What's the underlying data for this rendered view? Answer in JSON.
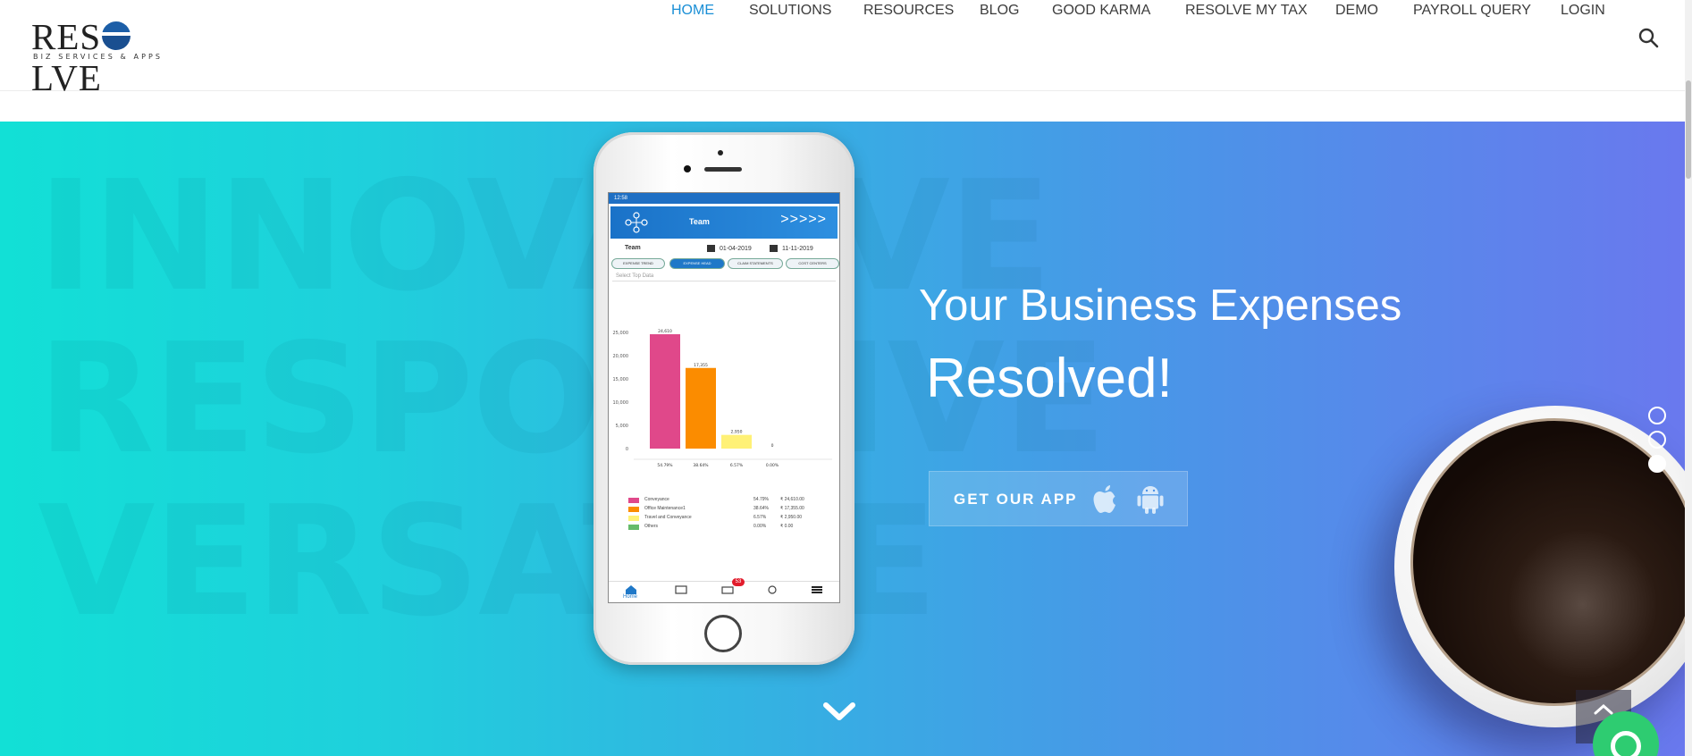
{
  "brand": {
    "name": "RESOLVE",
    "name_left": "RES",
    "name_right": "LVE",
    "tagline": "BIZ SERVICES & APPS"
  },
  "nav": {
    "items": [
      {
        "label": "HOME",
        "active": true
      },
      {
        "label": "SOLUTIONS",
        "active": false
      },
      {
        "label": "RESOURCES",
        "active": false
      },
      {
        "label": "BLOG",
        "active": false
      },
      {
        "label": "GOOD KARMA",
        "active": false
      },
      {
        "label": "RESOLVE MY TAX",
        "active": false
      },
      {
        "label": "DEMO",
        "active": false
      },
      {
        "label": "PAYROLL QUERY",
        "active": false
      },
      {
        "label": "LOGIN",
        "active": false
      }
    ],
    "search_icon": "search-icon",
    "active_color": "#1a8fd6"
  },
  "hero": {
    "background_words": [
      "INNOVATIVE",
      "RESPONSIVE",
      "VERSATILE"
    ],
    "headline_line1": "Your Business Expenses",
    "headline_line2": "Resolved!",
    "cta_label": "GET OUR APP",
    "cta_icons": [
      "apple-icon",
      "android-icon"
    ],
    "slider_dots": [
      false,
      false,
      true
    ],
    "gradient": [
      "#12e0d6",
      "#3aa9e4",
      "#6a78ee"
    ]
  },
  "phone_screen": {
    "status_text": "12:58",
    "header_title": "Team",
    "header_arrows": ">>>>>",
    "team_label": "Team",
    "date_from": "01-04-2019",
    "date_to": "11-11-2019",
    "pills": [
      "EXPENSE TREND",
      "EXPENSE HEAD",
      "CLAIM STATEMENTS",
      "COST CENTERS"
    ],
    "select_placeholder": "Select Top Data",
    "tab_home_label": "Home",
    "badge_count": "53"
  },
  "chart_data": {
    "type": "bar",
    "categories": [
      "Conveyance",
      "Office Maintenance1",
      "Travel and Conveyance",
      "Others"
    ],
    "values": [
      24610,
      17355,
      2950,
      0
    ],
    "value_labels": [
      "24,610",
      "17,355",
      "2,950",
      "0"
    ],
    "percent_labels": [
      "54.79%",
      "38.64%",
      "6.57%",
      "0.00%"
    ],
    "amount_labels": [
      "₹ 24,610.00",
      "₹ 17,355.00",
      "₹ 2,950.00",
      "₹ 0.00"
    ],
    "colors": [
      "#e0488a",
      "#fb8c00",
      "#fff176",
      "#66bb6a"
    ],
    "yticks": [
      "25,000",
      "20,000",
      "15,000",
      "10,000",
      "5,000",
      "0"
    ],
    "ylim": [
      0,
      25000
    ]
  }
}
